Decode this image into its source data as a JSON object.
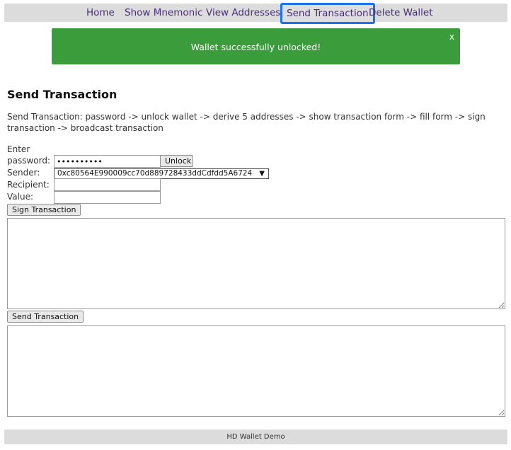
{
  "nav": {
    "items": [
      {
        "label": "Home"
      },
      {
        "label": "Show Mnemonic"
      },
      {
        "label": "View Addresses"
      },
      {
        "label": "Send Transaction"
      },
      {
        "label": "Delete Wallet"
      }
    ],
    "active_index": 3
  },
  "alert": {
    "message": "Wallet successfully unlocked!",
    "close": "x",
    "color": "#3a9c3a"
  },
  "page": {
    "title": "Send Transaction",
    "description": "Send Transaction: password -> unlock wallet -> derive 5 addresses -> show transaction form -> fill form -> sign transaction -> broadcast transaction"
  },
  "form": {
    "password_label_line1": "Enter",
    "password_label_line2": "password:",
    "password_value": "••••••••••",
    "unlock_label": "Unlock",
    "sender_label": "Sender:",
    "sender_value": "0xc80564E990009cc70d889728433ddCdfdd5A6724",
    "sender_caret": "▼",
    "recipient_label": "Recipient:",
    "recipient_value": "",
    "value_label": "Value:",
    "value_value": "",
    "sign_label": "Sign Transaction",
    "signed_tx_value": "",
    "send_label": "Send Transaction",
    "send_result_value": ""
  },
  "footer": {
    "text": "HD Wallet Demo"
  },
  "colors": {
    "nav_bg": "#dcdcdc",
    "nav_link": "#4a2d7a",
    "active_outline": "#1a73e8",
    "alert_success": "#3a9c3a"
  }
}
